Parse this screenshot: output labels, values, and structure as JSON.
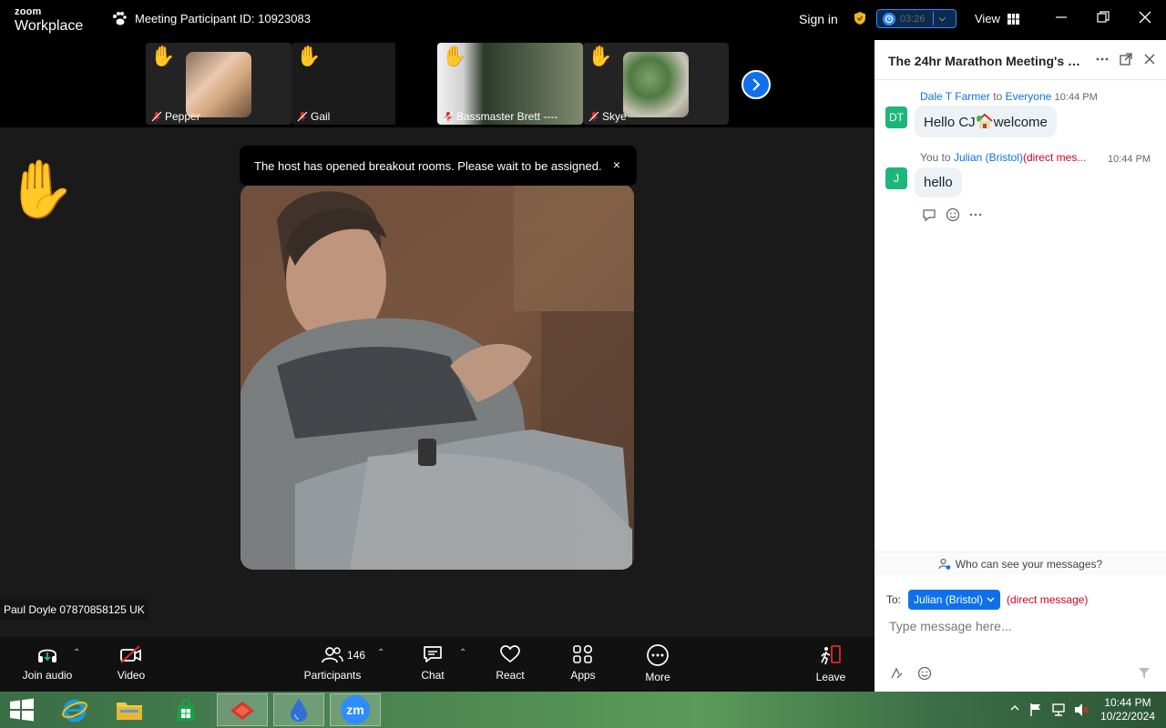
{
  "titlebar": {
    "logo_line1": "zoom",
    "logo_line2": "Workplace",
    "meeting_id": "Meeting Participant ID: 10923083",
    "sign_in": "Sign in",
    "timer": "03:26",
    "view": "View"
  },
  "thumbnails": [
    {
      "name": "Pepper",
      "hand_raised": true,
      "muted": true
    },
    {
      "name": "Gail",
      "hand_raised": true,
      "muted": true
    },
    {
      "name": "Bassmaster Brett ----",
      "hand_raised": true,
      "muted": true
    },
    {
      "name": "Skye",
      "hand_raised": true,
      "muted": true
    }
  ],
  "notice": {
    "text": "The host has opened breakout rooms. Please wait to be assigned.",
    "close": "×"
  },
  "speaker": {
    "name": "Paul Doyle 07870858125 UK",
    "hand_raised": true
  },
  "toolbar": {
    "join_audio": "Join audio",
    "video": "Video",
    "participants": "Participants",
    "participant_count": "146",
    "chat": "Chat",
    "react": "React",
    "apps": "Apps",
    "more": "More",
    "leave": "Leave"
  },
  "chat": {
    "title": "The 24hr Marathon Meeting's Pe...",
    "messages": [
      {
        "sender": "Dale T Farmer",
        "to_word": "to",
        "recipient": "Everyone",
        "time": "10:44 PM",
        "avatar": "DT",
        "text_before": "Hello CJ",
        "text_after": "welcome"
      },
      {
        "sender": "You to",
        "recipient": "Julian (Bristol)",
        "dm": "(direct mes...",
        "time": "10:44 PM",
        "avatar": "J",
        "text": "hello"
      }
    ],
    "who_can_see": "Who can see your messages?",
    "to_label": "To:",
    "to_recipient": "Julian (Bristol)",
    "to_dm": "(direct message)",
    "input_placeholder": "Type message here..."
  },
  "taskbar": {
    "zoom_label": "zm",
    "time": "10:44 PM",
    "date": "10/22/2024"
  },
  "colors": {
    "accent": "#0e71eb",
    "hand": "#f8c23a",
    "direct_message": "#d0021b",
    "avatar": "#1db67a"
  }
}
